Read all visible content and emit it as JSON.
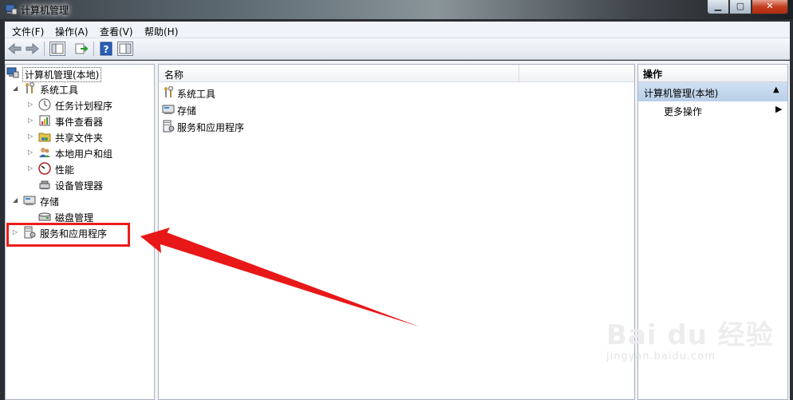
{
  "window": {
    "title": "计算机管理"
  },
  "menu": [
    {
      "label": "文件(F)"
    },
    {
      "label": "操作(A)"
    },
    {
      "label": "查看(V)"
    },
    {
      "label": "帮助(H)"
    }
  ],
  "tree": {
    "root": "计算机管理(本地)",
    "system_tools": "系统工具",
    "task_scheduler": "任务计划程序",
    "event_viewer": "事件查看器",
    "shared_folders": "共享文件夹",
    "local_users": "本地用户和组",
    "performance": "性能",
    "device_manager": "设备管理器",
    "storage": "存储",
    "disk_management": "磁盘管理",
    "services_apps": "服务和应用程序"
  },
  "list": {
    "column_name": "名称",
    "rows": [
      "系统工具",
      "存储",
      "服务和应用程序"
    ]
  },
  "actions": {
    "header": "操作",
    "section": "计算机管理(本地)",
    "more": "更多操作"
  },
  "watermark": {
    "logo": "Bai du 经验",
    "url": "jingyan.baidu.com"
  },
  "colors": {
    "highlight": "#ec1c1c",
    "action_section": "#c6d9ee"
  }
}
